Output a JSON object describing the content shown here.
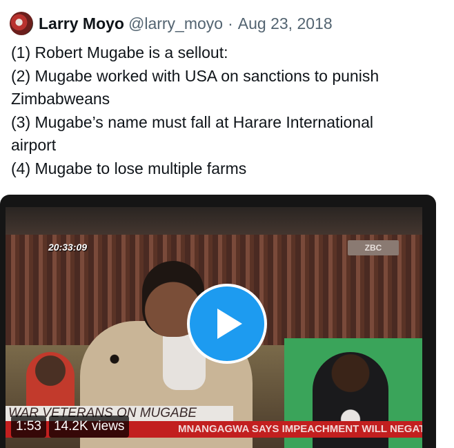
{
  "tweet": {
    "author_name": "Larry Moyo",
    "handle": "@larry_moyo",
    "separator": "·",
    "date": "Aug 23, 2018",
    "lines": [
      "(1) Robert Mugabe is a sellout:",
      "(2) Mugabe worked with USA on sanctions to punish",
      "Zimbabweans",
      "(3) Mugabe’s name must fall at Harare International",
      "airport",
      "(4) Mugabe to lose multiple farms"
    ]
  },
  "video": {
    "timestamp": "20:33:09",
    "channel_logo": "ZBC",
    "banner": "WAR VETERANS ON MUGABE",
    "ticker": "MNANGAGWA SAYS IMPEACHMENT WILL NEGATIVE",
    "duration": "1:53",
    "views": "14.2K views",
    "play_icon": "play-icon",
    "accent_color": "#1d9bf0"
  }
}
